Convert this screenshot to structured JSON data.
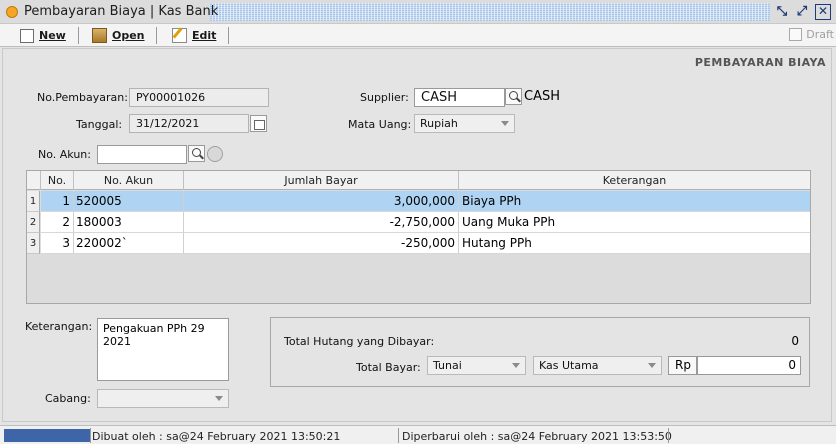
{
  "window": {
    "title": "Pembayaran Biaya | Kas Bank",
    "icons": [
      "restore-icon",
      "maximize-icon",
      "close-icon"
    ]
  },
  "toolbar": {
    "new_label": "New",
    "open_label": "Open",
    "edit_label": "Edit",
    "draft_label": "Draft"
  },
  "page": {
    "title": "PEMBAYARAN BIAYA"
  },
  "form": {
    "no_pembayaran_label": "No.Pembayaran:",
    "no_pembayaran_value": "PY00001026",
    "tanggal_label": "Tanggal:",
    "tanggal_value": "31/12/2021",
    "supplier_label": "Supplier:",
    "supplier_value": "CASH",
    "supplier_name": "CASH",
    "mata_uang_label": "Mata Uang:",
    "mata_uang_value": "Rupiah",
    "no_akun_label": "No. Akun:",
    "no_akun_value": ""
  },
  "table": {
    "headers": [
      "No.",
      "No. Akun",
      "Jumlah Bayar",
      "Keterangan"
    ],
    "rows": [
      {
        "row": "1",
        "no": "1",
        "akun": "520005",
        "jumlah": "3,000,000",
        "ket": "Biaya PPh"
      },
      {
        "row": "2",
        "no": "2",
        "akun": "180003",
        "jumlah": "-2,750,000",
        "ket": "Uang Muka PPh"
      },
      {
        "row": "3",
        "no": "3",
        "akun": "220002`",
        "jumlah": "-250,000",
        "ket": "Hutang PPh"
      }
    ],
    "selected_row": 1
  },
  "notes": {
    "keterangan_label": "Keterangan:",
    "keterangan_value": "Pengakuan PPh 29 2021",
    "cabang_label": "Cabang:",
    "cabang_value": ""
  },
  "totals": {
    "total_hutang_label": "Total Hutang yang Dibayar:",
    "total_hutang_value": "0",
    "total_bayar_label": "Total Bayar:",
    "payment_method": "Tunai",
    "account": "Kas Utama",
    "currency": "Rp",
    "amount": "0"
  },
  "status": {
    "created": "Dibuat oleh : sa@24 February 2021  13:50:21",
    "updated": "Diperbarui oleh : sa@24 February 2021  13:53:50"
  },
  "colors": {
    "selected_row": "#aed3f3",
    "titlebar_stripe": "#a9c6e8",
    "status_accent": "#3d65a8"
  }
}
